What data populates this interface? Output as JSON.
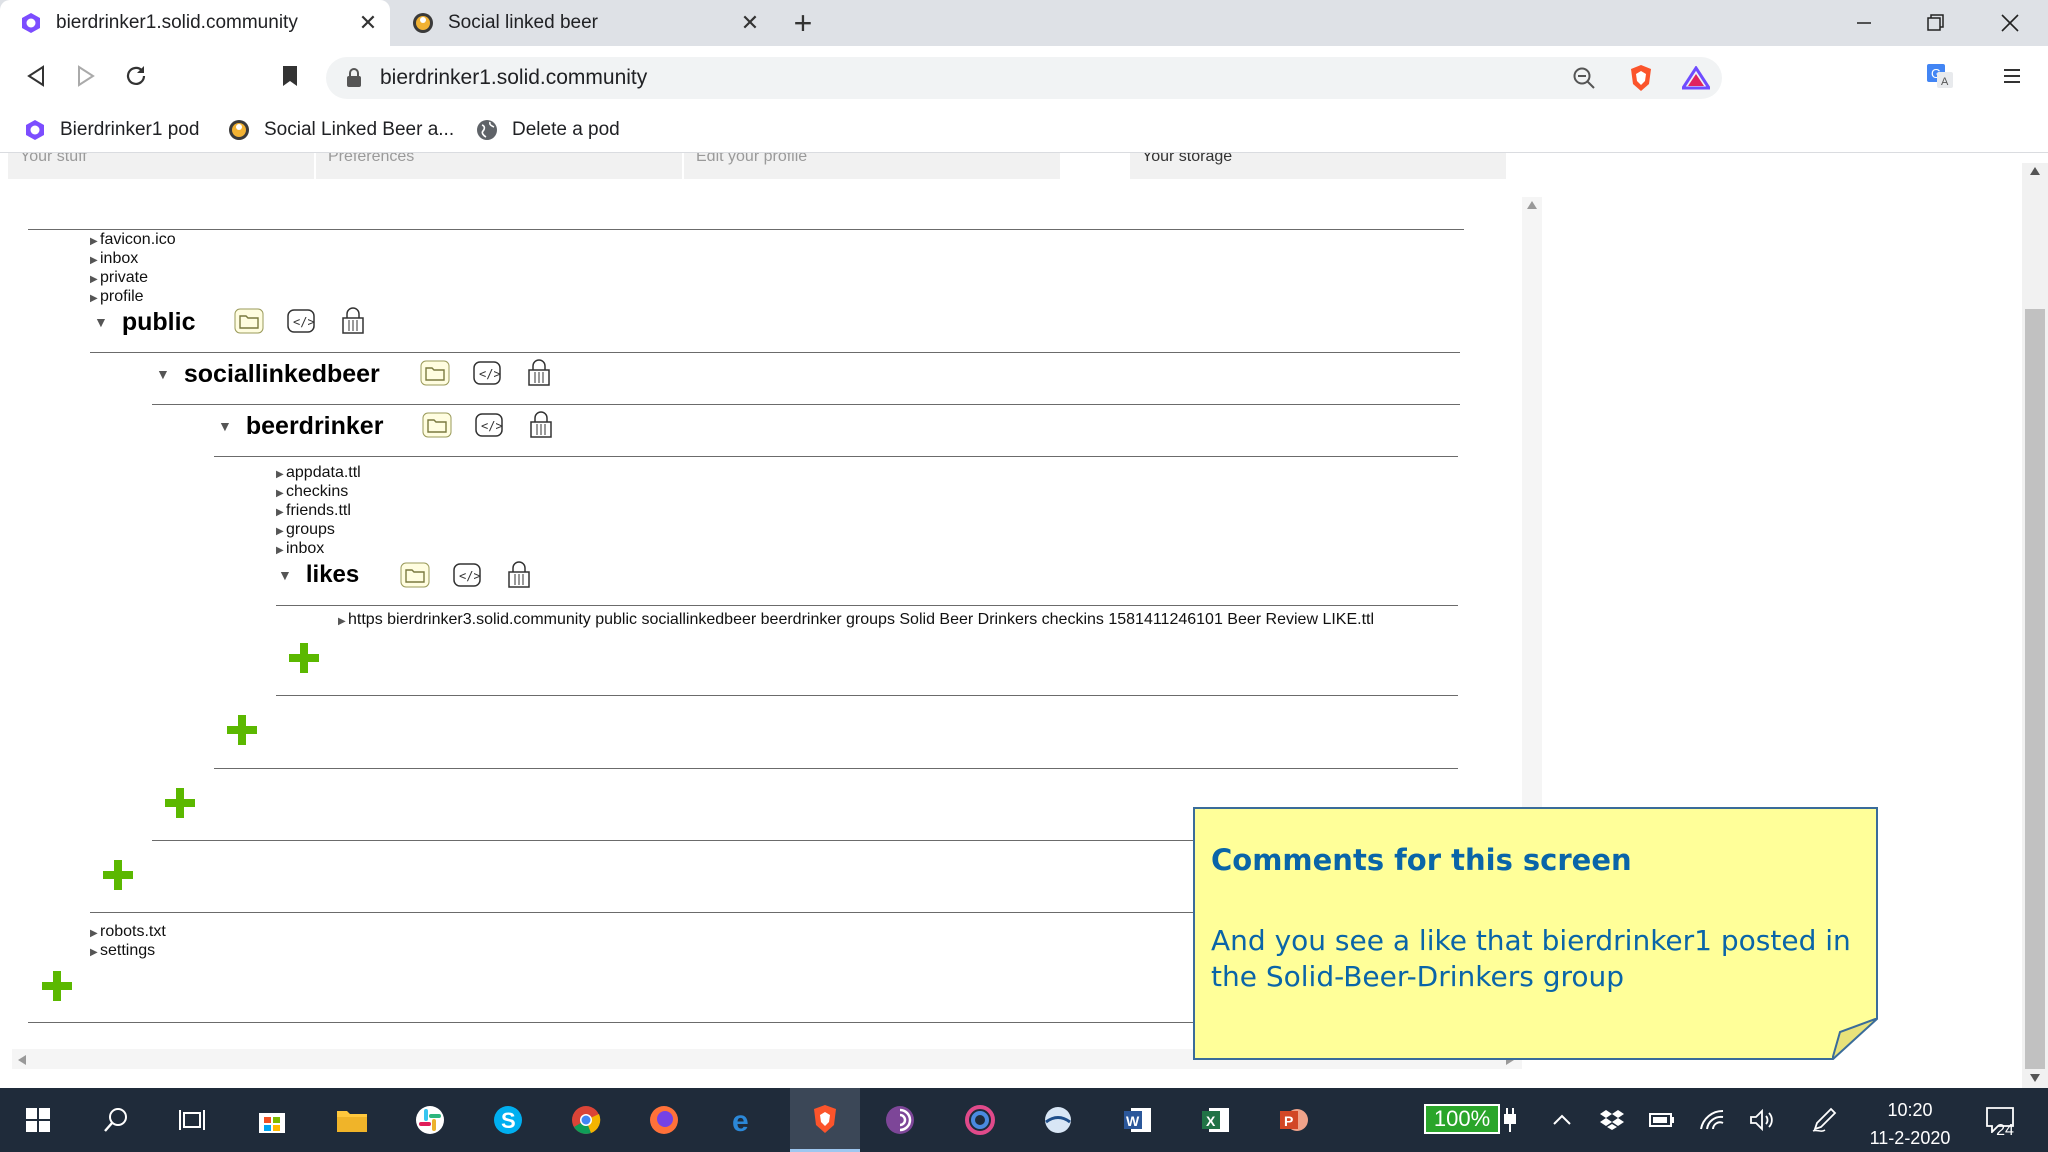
{
  "browser": {
    "tabs": [
      {
        "title": "bierdrinker1.solid.community",
        "active": true
      },
      {
        "title": "Social linked beer",
        "active": false
      }
    ],
    "address": "bierdrinker1.solid.community",
    "bookmarks": [
      "Bierdrinker1 pod",
      "Social Linked Beer a...",
      "Delete a pod"
    ]
  },
  "page": {
    "top_tabs": [
      "Your stuff",
      "Preferences",
      "Edit your profile",
      "Your storage"
    ],
    "root_files_top": [
      "favicon.ico",
      "inbox",
      "private",
      "profile"
    ],
    "public_label": "public",
    "sociallinkedbeer_label": "sociallinkedbeer",
    "beerdrinker_label": "beerdrinker",
    "beerdrinker_files": [
      "appdata.ttl",
      "checkins",
      "friends.ttl",
      "groups",
      "inbox"
    ],
    "likes_label": "likes",
    "likes_file": "https bierdrinker3.solid.community public sociallinkedbeer beerdrinker groups Solid Beer Drinkers checkins 1581411246101 Beer Review LIKE.ttl",
    "root_files_bottom": [
      "robots.txt",
      "settings"
    ]
  },
  "note": {
    "title": "Comments for this screen",
    "body": "And you see a like that bierdrinker1 posted in the Solid-Beer-Drinkers group"
  },
  "taskbar": {
    "battery": "100%",
    "time": "10:20",
    "date": "11-2-2020",
    "notifications": "24"
  },
  "colors": {
    "plus": "#5bb800",
    "note_bg": "#ffff99",
    "note_text": "#0a65a8",
    "taskbar": "#1f2b3a"
  }
}
